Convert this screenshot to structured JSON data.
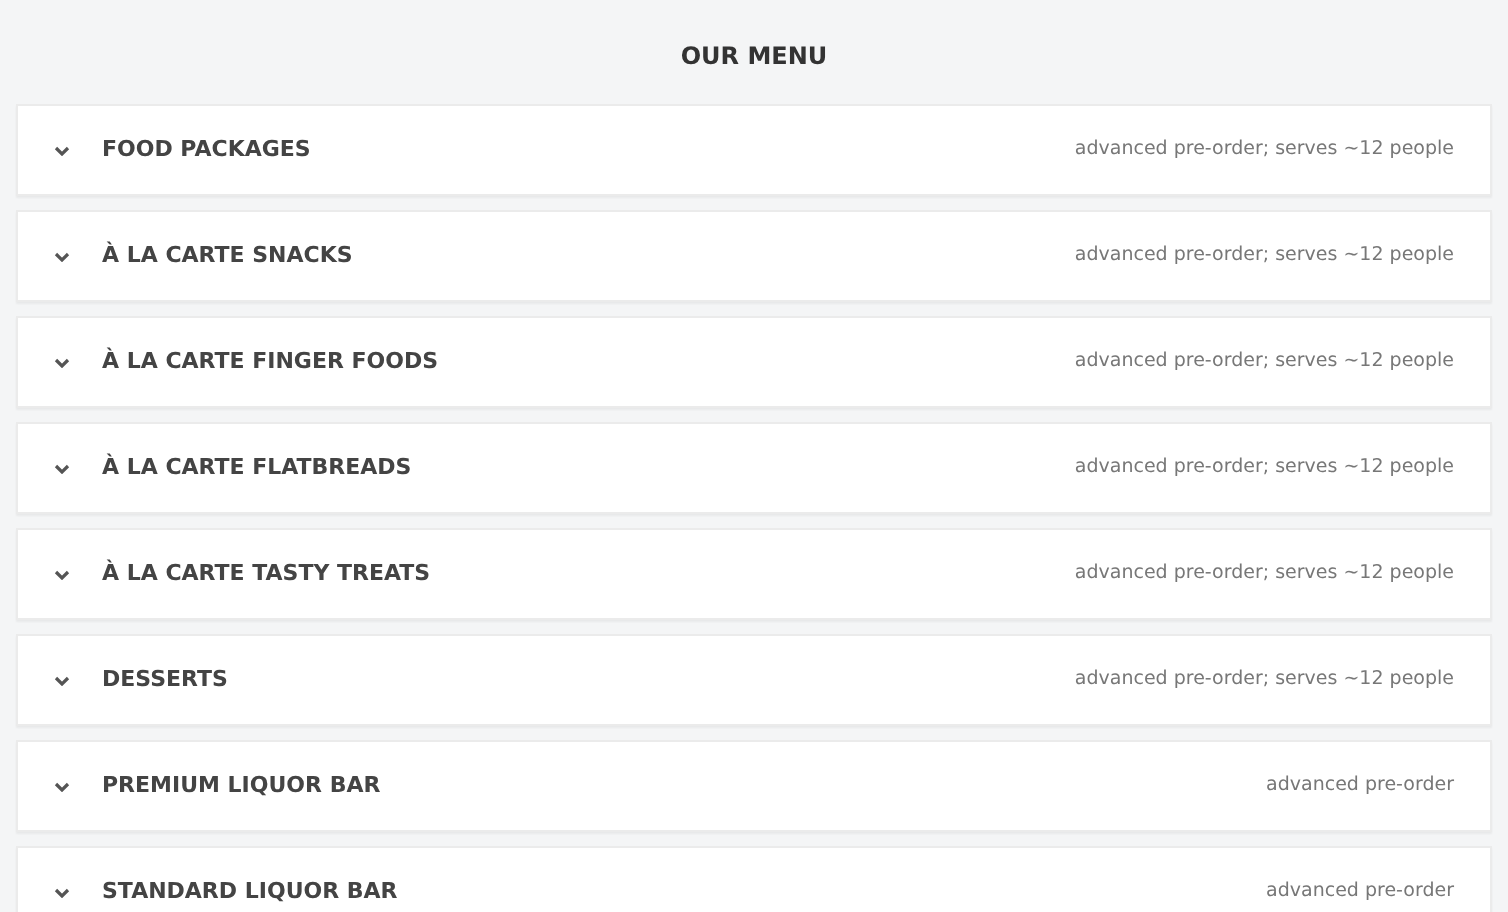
{
  "title": "OUR MENU",
  "sections": [
    {
      "label": "FOOD PACKAGES",
      "note": "advanced pre-order; serves ~12 people"
    },
    {
      "label": "À LA CARTE SNACKS",
      "note": "advanced pre-order; serves ~12 people"
    },
    {
      "label": "À LA CARTE FINGER FOODS",
      "note": "advanced pre-order; serves ~12 people"
    },
    {
      "label": "À LA CARTE FLATBREADS",
      "note": "advanced pre-order; serves ~12 people"
    },
    {
      "label": "À LA CARTE TASTY TREATS",
      "note": "advanced pre-order; serves ~12 people"
    },
    {
      "label": "DESSERTS",
      "note": "advanced pre-order; serves ~12 people"
    },
    {
      "label": "PREMIUM LIQUOR BAR",
      "note": "advanced pre-order"
    },
    {
      "label": "STANDARD LIQUOR BAR",
      "note": "advanced pre-order"
    }
  ]
}
